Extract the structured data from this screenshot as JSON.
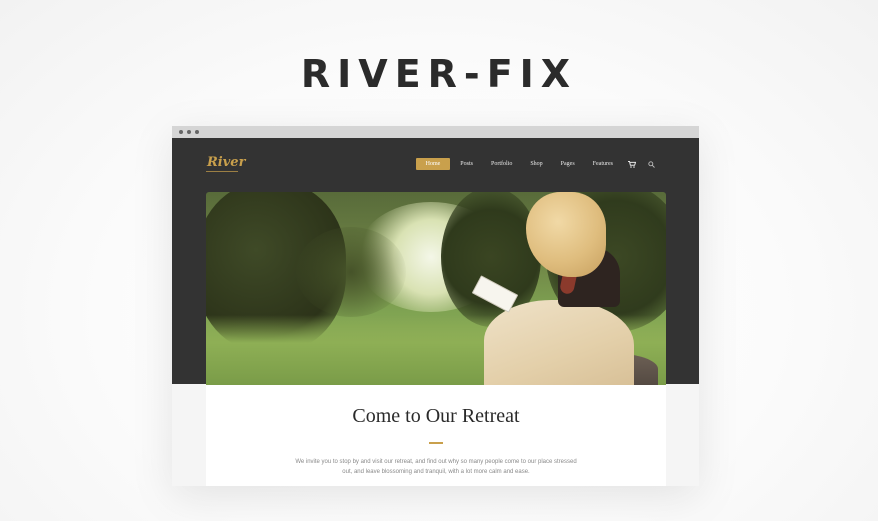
{
  "promo": {
    "title": "RIVER-FIX"
  },
  "site": {
    "logo": "River",
    "nav": [
      {
        "label": "Home",
        "active": true
      },
      {
        "label": "Posts"
      },
      {
        "label": "Portfolio"
      },
      {
        "label": "Shop"
      },
      {
        "label": "Pages"
      },
      {
        "label": "Features"
      }
    ],
    "nav_icons": [
      "cart-icon",
      "search-icon"
    ],
    "hero": {
      "image": "woman reading book on rock in meadow"
    },
    "content": {
      "title": "Come to Our Retreat",
      "text_line1": "We invite you to stop by and visit our retreat, and find out why so many people  come to our place stressed",
      "text_line2": "out, and leave blossoming and tranquil, with a lot more calm and ease."
    }
  },
  "colors": {
    "accent": "#c9a04c",
    "header_bg": "#333333",
    "title_text": "#2b2b2b"
  }
}
